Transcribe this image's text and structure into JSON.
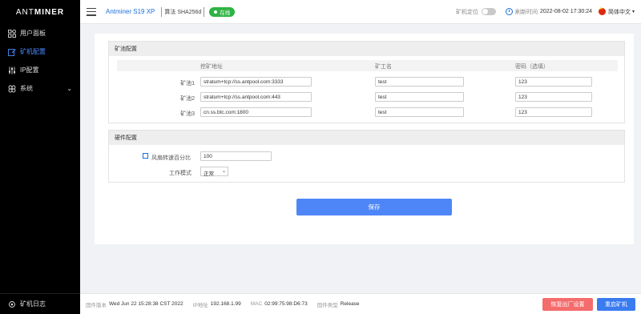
{
  "brand": {
    "logo_light": "ANT",
    "logo_bold": "MINER"
  },
  "sidebar": {
    "items": [
      {
        "label": "用户面板",
        "icon": "grid-icon"
      },
      {
        "label": "矿机配置",
        "icon": "edit-config-icon",
        "active": true
      },
      {
        "label": "IP配置",
        "icon": "sliders-icon"
      },
      {
        "label": "系统",
        "icon": "system-icon",
        "has_submenu": true
      }
    ],
    "footer_label": "矿机日志"
  },
  "topbar": {
    "model": "Antminer S19 XP",
    "algorithm": "算法 SHA256d",
    "status": "在线",
    "locate_label": "矿机定位",
    "refresh_label": "刷新时间",
    "datetime": "2022-08-02 17:30:24",
    "language": "简体中文"
  },
  "pool_config": {
    "title": "矿池配置",
    "headers": {
      "url": "挖矿地址",
      "worker": "矿工名",
      "password": "密码（选填）"
    },
    "rows": [
      {
        "label": "矿池1",
        "url": "stratum+tcp://ss.antpool.com:3333",
        "worker": "test",
        "password": "123"
      },
      {
        "label": "矿池2",
        "url": "stratum+tcp://ss.antpool.com:443",
        "worker": "test",
        "password": "123"
      },
      {
        "label": "矿池3",
        "url": "cn.ss.btc.com:1800",
        "worker": "test",
        "password": "123"
      }
    ]
  },
  "hardware_config": {
    "title": "硬件配置",
    "fan_label": "风扇转速百分比",
    "fan_value": "100",
    "fan_checked": false,
    "mode_label": "工作模式",
    "mode_value": "正常"
  },
  "save_label": "保存",
  "footer": {
    "firmware_label": "固件版本",
    "firmware_value": "Wed Jun 22 15:28:38 CST 2022",
    "ip_label": "IP地址",
    "ip_value": "192.168.1.99",
    "mac_label": "MAC",
    "mac_value": "02:99:75:98:D6:73",
    "fw_type_label": "固件类型",
    "fw_type_value": "Release",
    "reset_label": "恢复出厂设置",
    "reboot_label": "重启矿机"
  },
  "colors": {
    "accent": "#4f86f7",
    "online": "#2fb344",
    "danger": "#f56c6c",
    "sidebar_bg": "#000000"
  }
}
